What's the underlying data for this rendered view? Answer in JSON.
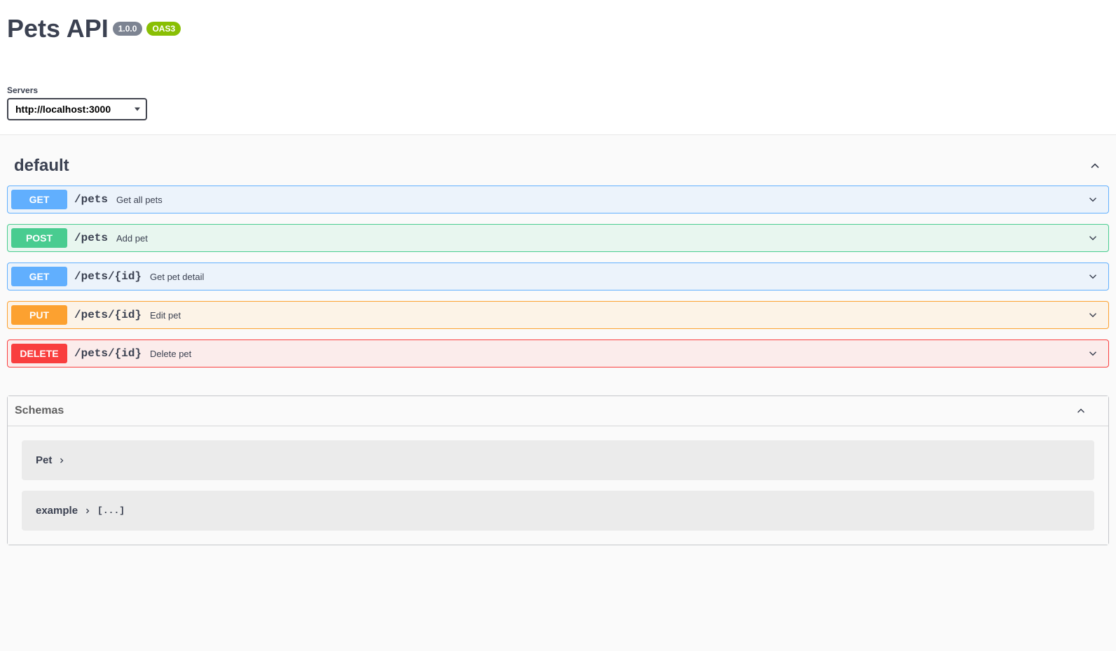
{
  "api": {
    "title": "Pets API",
    "version": "1.0.0",
    "oas": "OAS3"
  },
  "servers": {
    "label": "Servers",
    "selected": "http://localhost:3000"
  },
  "tag": {
    "name": "default"
  },
  "operations": [
    {
      "method": "GET",
      "path": "/pets",
      "summary": "Get all pets",
      "class": "get"
    },
    {
      "method": "POST",
      "path": "/pets",
      "summary": "Add pet",
      "class": "post"
    },
    {
      "method": "GET",
      "path": "/pets/{id}",
      "summary": "Get pet detail",
      "class": "get"
    },
    {
      "method": "PUT",
      "path": "/pets/{id}",
      "summary": "Edit pet",
      "class": "put"
    },
    {
      "method": "DELETE",
      "path": "/pets/{id}",
      "summary": "Delete pet",
      "class": "delete"
    }
  ],
  "schemas": {
    "title": "Schemas",
    "items": [
      {
        "name": "Pet",
        "suffix": ""
      },
      {
        "name": "example",
        "suffix": "[...]"
      }
    ]
  }
}
